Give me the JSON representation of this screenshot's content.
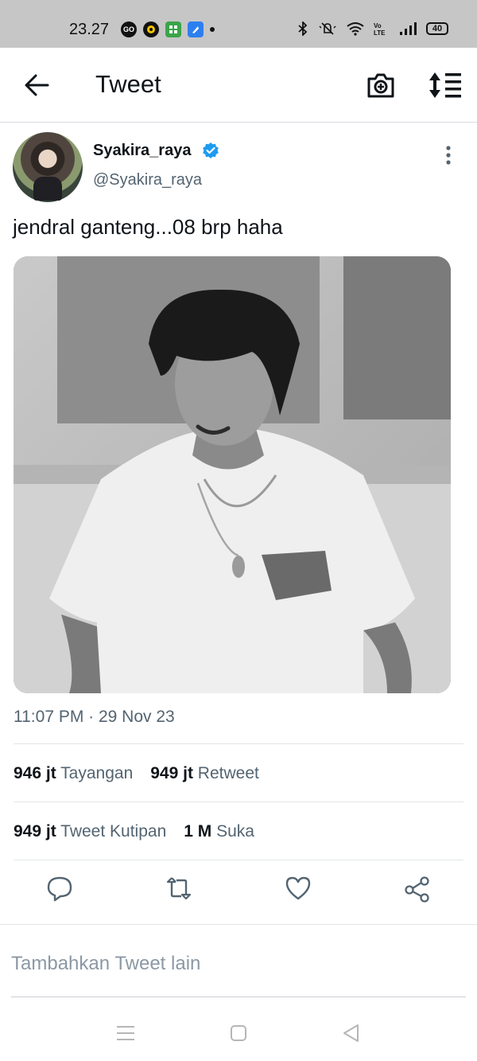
{
  "status_bar": {
    "time": "23.27",
    "battery": "40",
    "left_icons": [
      "go-app-icon",
      "chat-app-icon",
      "calculator-app-icon",
      "files-app-icon",
      "notification-dot-icon"
    ],
    "right_icons": [
      "bluetooth-icon",
      "mute-bell-icon",
      "wifi-icon",
      "volte-icon",
      "signal-icon",
      "battery-icon"
    ]
  },
  "header": {
    "title": "Tweet"
  },
  "tweet": {
    "display_name": "Syakira_raya",
    "handle": "@Syakira_raya",
    "verified": true,
    "text": "jendral ganteng...08 brp haha",
    "timestamp": "11:07 PM · 29 Nov 23",
    "stats_row1": [
      {
        "value": "946 jt",
        "label": "Tayangan"
      },
      {
        "value": "949 jt",
        "label": "Retweet"
      }
    ],
    "stats_row2": [
      {
        "value": "949 jt",
        "label": "Tweet Kutipan"
      },
      {
        "value": "1 M",
        "label": "Suka"
      }
    ]
  },
  "compose": {
    "placeholder": "Tambahkan Tweet lain"
  },
  "colors": {
    "accent": "#1d9bf0",
    "secondary_text": "#536471",
    "status_bar_bg": "#c6c6c6"
  }
}
